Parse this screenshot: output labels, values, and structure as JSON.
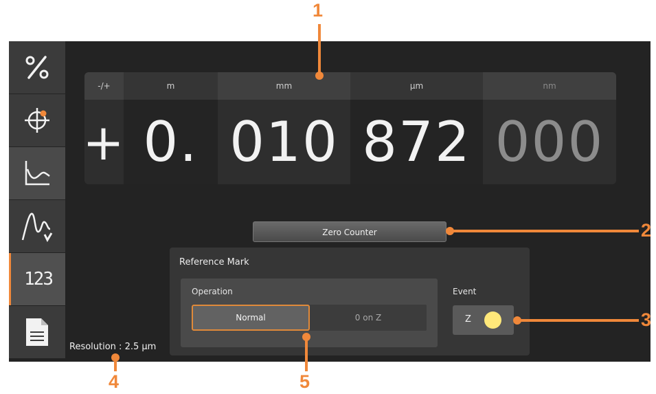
{
  "sidebar": {
    "items": [
      {
        "name": "percent",
        "icon": "percent-icon"
      },
      {
        "name": "target",
        "icon": "crosshair-icon"
      },
      {
        "name": "graph",
        "icon": "line-chart-icon"
      },
      {
        "name": "signal",
        "icon": "signal-wave-icon"
      },
      {
        "name": "counter",
        "icon": "counter-123-icon",
        "label": "123",
        "active": true
      },
      {
        "name": "document",
        "icon": "document-icon"
      }
    ]
  },
  "counter": {
    "columns": [
      {
        "header": "-/+",
        "value": "+"
      },
      {
        "header": "m",
        "value": "0."
      },
      {
        "header": "mm",
        "value": "010"
      },
      {
        "header": "µm",
        "value": "872"
      },
      {
        "header": "nm",
        "value": "000"
      }
    ]
  },
  "zero_counter": {
    "label": "Zero Counter"
  },
  "reference_mark": {
    "title": "Reference Mark",
    "operation": {
      "title": "Operation",
      "options": [
        "Normal",
        "0 on Z"
      ],
      "selected": "Normal"
    },
    "event": {
      "title": "Event",
      "label": "Z",
      "led_color": "#ffe87a"
    }
  },
  "status": {
    "resolution": "Resolution : 2.5 µm"
  },
  "callouts": [
    "1",
    "2",
    "3",
    "4",
    "5"
  ],
  "colors": {
    "accent": "#f0883a",
    "background": "#232323"
  }
}
